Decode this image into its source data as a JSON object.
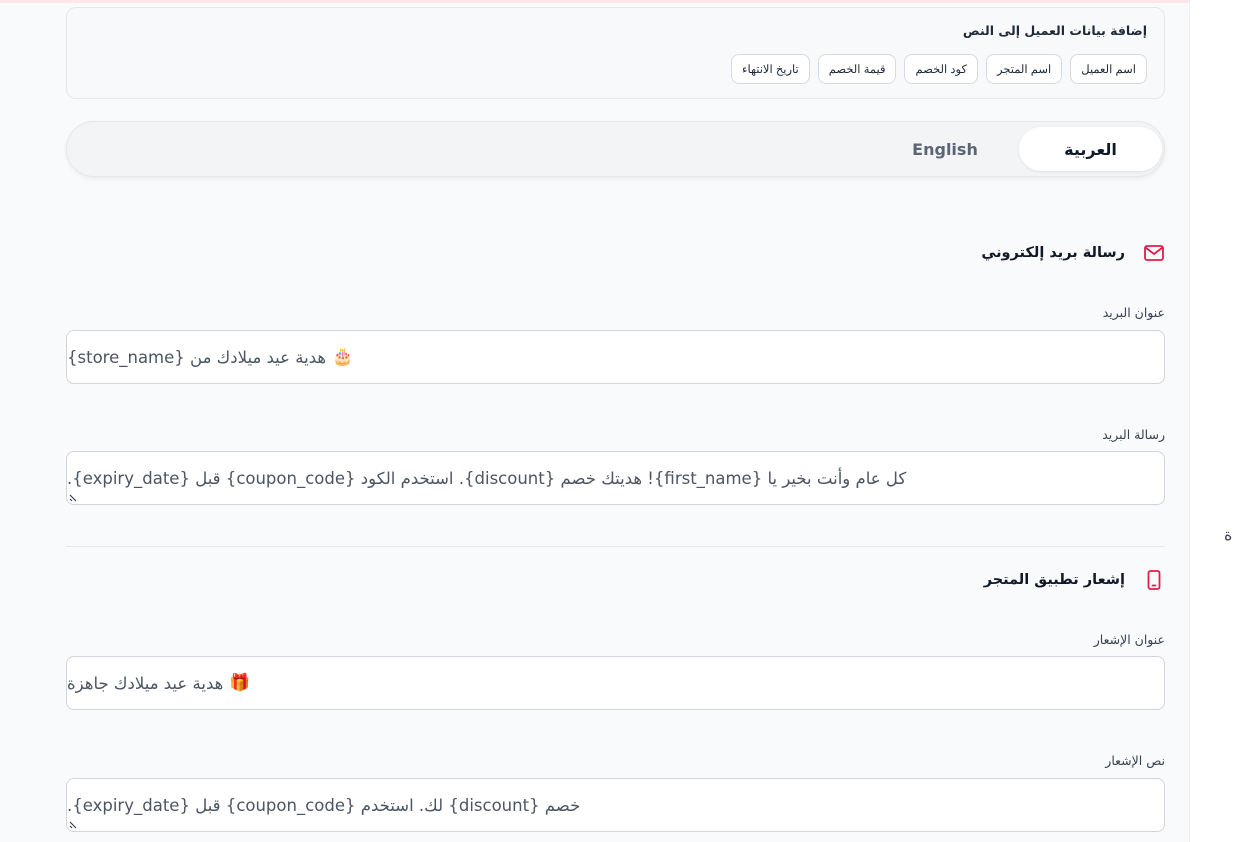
{
  "variables": {
    "title": "إضافة بيانات العميل إلى النص",
    "chips": [
      "اسم العميل",
      "اسم المتجر",
      "كود الخصم",
      "قيمة الخصم",
      "تاريخ الانتهاء"
    ]
  },
  "language_tabs": {
    "arabic": "العربية",
    "english": "English",
    "active": "arabic"
  },
  "email": {
    "section_title": "رسالة بريد إلكتروني",
    "subject_label": "عنوان البريد",
    "subject_emoji": "🎂",
    "subject_value": "هدية عيد ميلادك من {store_name}",
    "message_label": "رسالة البريد",
    "message_value": "كل عام وأنت بخير يا {first_name}! هديتك خصم {discount}. استخدم الكود {coupon_code} قبل {expiry_date}."
  },
  "push": {
    "section_title": "إشعار تطبيق المتجر",
    "title_label": "عنوان الإشعار",
    "title_emoji": "🎁",
    "title_value": "هدية عيد ميلادك جاهزة",
    "body_label": "نص الإشعار",
    "body_value": "خصم {discount} لك. استخدم {coupon_code} قبل {expiry_date}."
  },
  "side_glyph": "ة",
  "colors": {
    "accent": "#e11d48",
    "active_tab_bg": "#ffffff",
    "tabs_bg": "#f3f4f6"
  }
}
